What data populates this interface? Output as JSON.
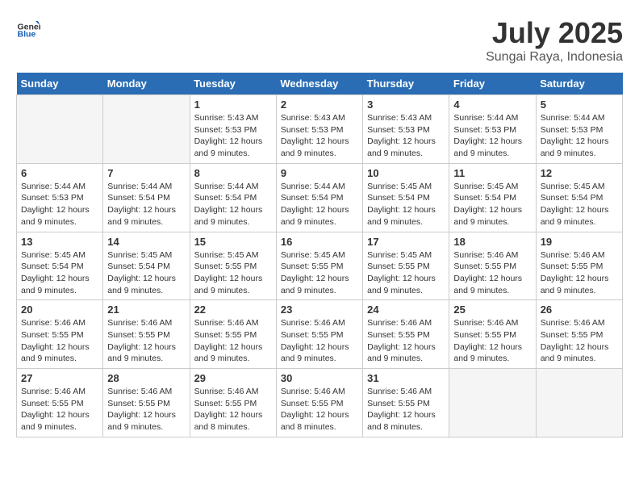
{
  "header": {
    "logo_general": "General",
    "logo_blue": "Blue",
    "month": "July 2025",
    "location": "Sungai Raya, Indonesia"
  },
  "weekdays": [
    "Sunday",
    "Monday",
    "Tuesday",
    "Wednesday",
    "Thursday",
    "Friday",
    "Saturday"
  ],
  "weeks": [
    [
      {
        "day": "",
        "info": ""
      },
      {
        "day": "",
        "info": ""
      },
      {
        "day": "1",
        "info": "Sunrise: 5:43 AM\nSunset: 5:53 PM\nDaylight: 12 hours\nand 9 minutes."
      },
      {
        "day": "2",
        "info": "Sunrise: 5:43 AM\nSunset: 5:53 PM\nDaylight: 12 hours\nand 9 minutes."
      },
      {
        "day": "3",
        "info": "Sunrise: 5:43 AM\nSunset: 5:53 PM\nDaylight: 12 hours\nand 9 minutes."
      },
      {
        "day": "4",
        "info": "Sunrise: 5:44 AM\nSunset: 5:53 PM\nDaylight: 12 hours\nand 9 minutes."
      },
      {
        "day": "5",
        "info": "Sunrise: 5:44 AM\nSunset: 5:53 PM\nDaylight: 12 hours\nand 9 minutes."
      }
    ],
    [
      {
        "day": "6",
        "info": "Sunrise: 5:44 AM\nSunset: 5:53 PM\nDaylight: 12 hours\nand 9 minutes."
      },
      {
        "day": "7",
        "info": "Sunrise: 5:44 AM\nSunset: 5:54 PM\nDaylight: 12 hours\nand 9 minutes."
      },
      {
        "day": "8",
        "info": "Sunrise: 5:44 AM\nSunset: 5:54 PM\nDaylight: 12 hours\nand 9 minutes."
      },
      {
        "day": "9",
        "info": "Sunrise: 5:44 AM\nSunset: 5:54 PM\nDaylight: 12 hours\nand 9 minutes."
      },
      {
        "day": "10",
        "info": "Sunrise: 5:45 AM\nSunset: 5:54 PM\nDaylight: 12 hours\nand 9 minutes."
      },
      {
        "day": "11",
        "info": "Sunrise: 5:45 AM\nSunset: 5:54 PM\nDaylight: 12 hours\nand 9 minutes."
      },
      {
        "day": "12",
        "info": "Sunrise: 5:45 AM\nSunset: 5:54 PM\nDaylight: 12 hours\nand 9 minutes."
      }
    ],
    [
      {
        "day": "13",
        "info": "Sunrise: 5:45 AM\nSunset: 5:54 PM\nDaylight: 12 hours\nand 9 minutes."
      },
      {
        "day": "14",
        "info": "Sunrise: 5:45 AM\nSunset: 5:54 PM\nDaylight: 12 hours\nand 9 minutes."
      },
      {
        "day": "15",
        "info": "Sunrise: 5:45 AM\nSunset: 5:55 PM\nDaylight: 12 hours\nand 9 minutes."
      },
      {
        "day": "16",
        "info": "Sunrise: 5:45 AM\nSunset: 5:55 PM\nDaylight: 12 hours\nand 9 minutes."
      },
      {
        "day": "17",
        "info": "Sunrise: 5:45 AM\nSunset: 5:55 PM\nDaylight: 12 hours\nand 9 minutes."
      },
      {
        "day": "18",
        "info": "Sunrise: 5:46 AM\nSunset: 5:55 PM\nDaylight: 12 hours\nand 9 minutes."
      },
      {
        "day": "19",
        "info": "Sunrise: 5:46 AM\nSunset: 5:55 PM\nDaylight: 12 hours\nand 9 minutes."
      }
    ],
    [
      {
        "day": "20",
        "info": "Sunrise: 5:46 AM\nSunset: 5:55 PM\nDaylight: 12 hours\nand 9 minutes."
      },
      {
        "day": "21",
        "info": "Sunrise: 5:46 AM\nSunset: 5:55 PM\nDaylight: 12 hours\nand 9 minutes."
      },
      {
        "day": "22",
        "info": "Sunrise: 5:46 AM\nSunset: 5:55 PM\nDaylight: 12 hours\nand 9 minutes."
      },
      {
        "day": "23",
        "info": "Sunrise: 5:46 AM\nSunset: 5:55 PM\nDaylight: 12 hours\nand 9 minutes."
      },
      {
        "day": "24",
        "info": "Sunrise: 5:46 AM\nSunset: 5:55 PM\nDaylight: 12 hours\nand 9 minutes."
      },
      {
        "day": "25",
        "info": "Sunrise: 5:46 AM\nSunset: 5:55 PM\nDaylight: 12 hours\nand 9 minutes."
      },
      {
        "day": "26",
        "info": "Sunrise: 5:46 AM\nSunset: 5:55 PM\nDaylight: 12 hours\nand 9 minutes."
      }
    ],
    [
      {
        "day": "27",
        "info": "Sunrise: 5:46 AM\nSunset: 5:55 PM\nDaylight: 12 hours\nand 9 minutes."
      },
      {
        "day": "28",
        "info": "Sunrise: 5:46 AM\nSunset: 5:55 PM\nDaylight: 12 hours\nand 9 minutes."
      },
      {
        "day": "29",
        "info": "Sunrise: 5:46 AM\nSunset: 5:55 PM\nDaylight: 12 hours\nand 8 minutes."
      },
      {
        "day": "30",
        "info": "Sunrise: 5:46 AM\nSunset: 5:55 PM\nDaylight: 12 hours\nand 8 minutes."
      },
      {
        "day": "31",
        "info": "Sunrise: 5:46 AM\nSunset: 5:55 PM\nDaylight: 12 hours\nand 8 minutes."
      },
      {
        "day": "",
        "info": ""
      },
      {
        "day": "",
        "info": ""
      }
    ]
  ]
}
